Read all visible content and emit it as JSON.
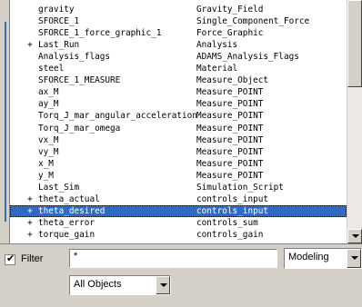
{
  "rows": [
    {
      "expander": "",
      "name": "gravity",
      "type": "Gravity_Field"
    },
    {
      "expander": "",
      "name": "SFORCE_1",
      "type": "Single_Component_Force"
    },
    {
      "expander": "",
      "name": "SFORCE_1_force_graphic_1",
      "type": "Force_Graphic"
    },
    {
      "expander": "+",
      "name": "Last_Run",
      "type": "Analysis"
    },
    {
      "expander": "",
      "name": "Analysis_flags",
      "type": "ADAMS_Analysis_Flags"
    },
    {
      "expander": "",
      "name": "steel",
      "type": "Material"
    },
    {
      "expander": "",
      "name": "SFORCE_1_MEASURE",
      "type": "Measure_Object"
    },
    {
      "expander": "",
      "name": "ax_M",
      "type": "Measure_POINT"
    },
    {
      "expander": "",
      "name": "ay_M",
      "type": "Measure_POINT"
    },
    {
      "expander": "",
      "name": "Torq_J_mar_angular_acceleration",
      "type": "Measure_POINT"
    },
    {
      "expander": "",
      "name": "Torq_J_mar_omega",
      "type": "Measure_POINT"
    },
    {
      "expander": "",
      "name": "vx_M",
      "type": "Measure_POINT"
    },
    {
      "expander": "",
      "name": "vy_M",
      "type": "Measure_POINT"
    },
    {
      "expander": "",
      "name": "x_M",
      "type": "Measure_POINT"
    },
    {
      "expander": "",
      "name": "y_M",
      "type": "Measure_POINT"
    },
    {
      "expander": "",
      "name": "Last_Sim",
      "type": "Simulation_Script"
    },
    {
      "expander": "+",
      "name": "theta_actual",
      "type": "controls_input"
    },
    {
      "expander": "+",
      "name": "theta_desired",
      "type": "controls_input",
      "selected": true
    },
    {
      "expander": "+",
      "name": "theta_error",
      "type": "controls_sum"
    },
    {
      "expander": "+",
      "name": "torque_gain",
      "type": "controls_gain"
    }
  ],
  "filter": {
    "checked": true,
    "check_glyph": "✔",
    "label": "Filter",
    "value": "*",
    "mode": "Modeling",
    "objects": "All Objects"
  },
  "colors": {
    "selection": "#316ac5",
    "panel": "#d4d0c8"
  }
}
